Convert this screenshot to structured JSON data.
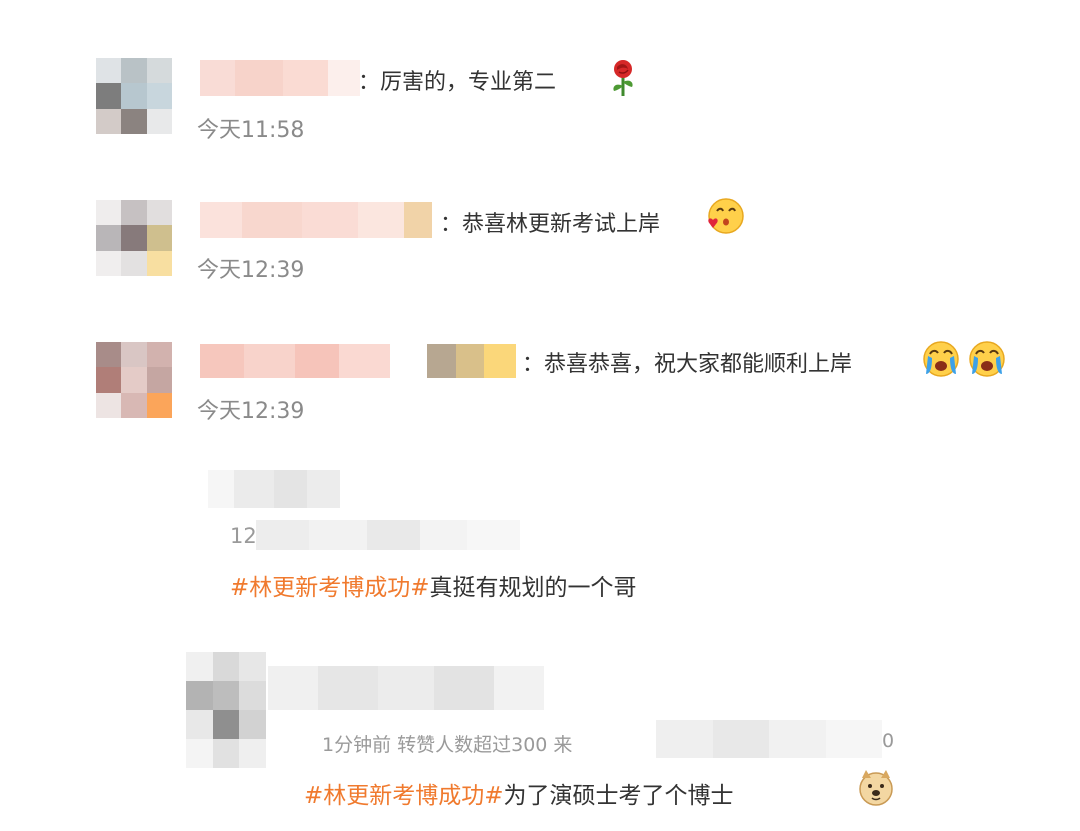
{
  "comments": [
    {
      "text": "：厉害的，专业第二",
      "emoji": "rose-icon",
      "time": "今天11:58"
    },
    {
      "text": "：恭喜林更新考试上岸",
      "emoji": "blowing-kiss-emoji",
      "time": "今天12:39"
    },
    {
      "text": "：恭喜恭喜，祝大家都能顺利上岸",
      "emoji": "crying-emoji",
      "time": "今天12:39"
    }
  ],
  "reposts": [
    {
      "meta_prefix": "12",
      "hashtag": "#林更新考博成功#",
      "text": "真挺有规划的一个哥"
    },
    {
      "meta": "1分钟前 转赞人数超过300 来",
      "meta_suffix": "0",
      "hashtag": "#林更新考博成功#",
      "text": "为了演硕士考了个博士",
      "emoji": "doge-emoji"
    }
  ],
  "colors": {
    "hashtag": "#f07a2e",
    "time": "#8a8a8a",
    "text": "#333333"
  }
}
